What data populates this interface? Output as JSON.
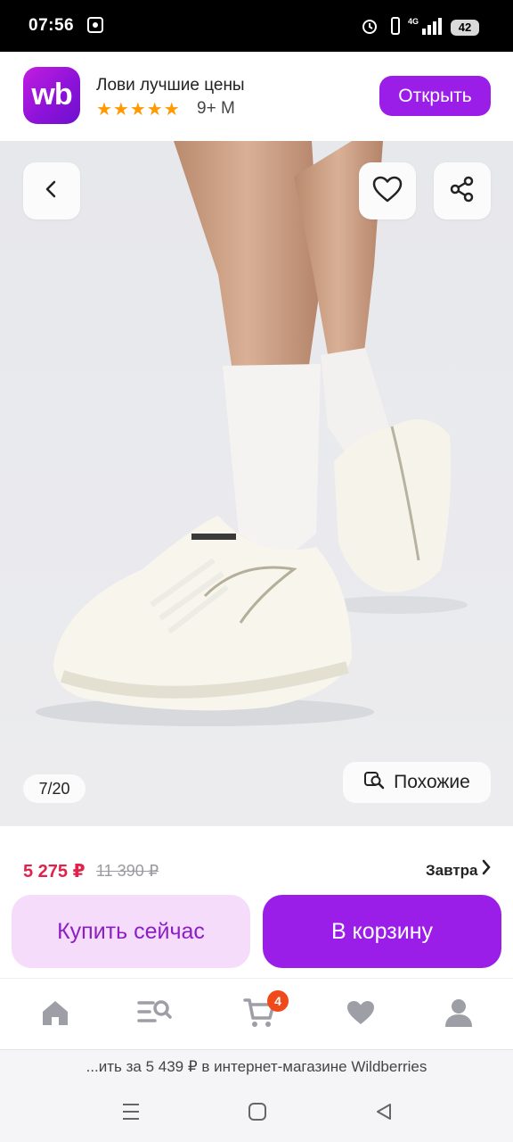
{
  "status_bar": {
    "time": "07:56",
    "battery": "42"
  },
  "app_banner": {
    "logo_text": "wb",
    "title": "Лови лучшие цены",
    "stars": "★★★★★",
    "rating_label": "9+ M",
    "open_label": "Открыть"
  },
  "gallery": {
    "counter": "7/20",
    "similar_label": "Похожие",
    "icons": [
      "back-arrow-icon",
      "heart-icon",
      "share-icon",
      "similar-search-icon"
    ]
  },
  "pricing": {
    "price": "5 275 ₽",
    "old_price": "11 390 ₽",
    "delivery": "Завтра"
  },
  "actions": {
    "buy_now": "Купить сейчас",
    "add_to_cart": "В корзину"
  },
  "bottom_nav": {
    "items": [
      "home-icon",
      "catalog-search-icon",
      "cart-icon",
      "favorites-icon",
      "profile-icon"
    ],
    "cart_count": "4"
  },
  "browser": {
    "url_text": "...ить за 5 439 ₽ в интернет-магазине Wildberries"
  },
  "colors": {
    "accent": "#9b1ee8",
    "price": "#e0234b",
    "badge": "#f04a1b",
    "buy_now_bg": "#f5dcfb"
  }
}
